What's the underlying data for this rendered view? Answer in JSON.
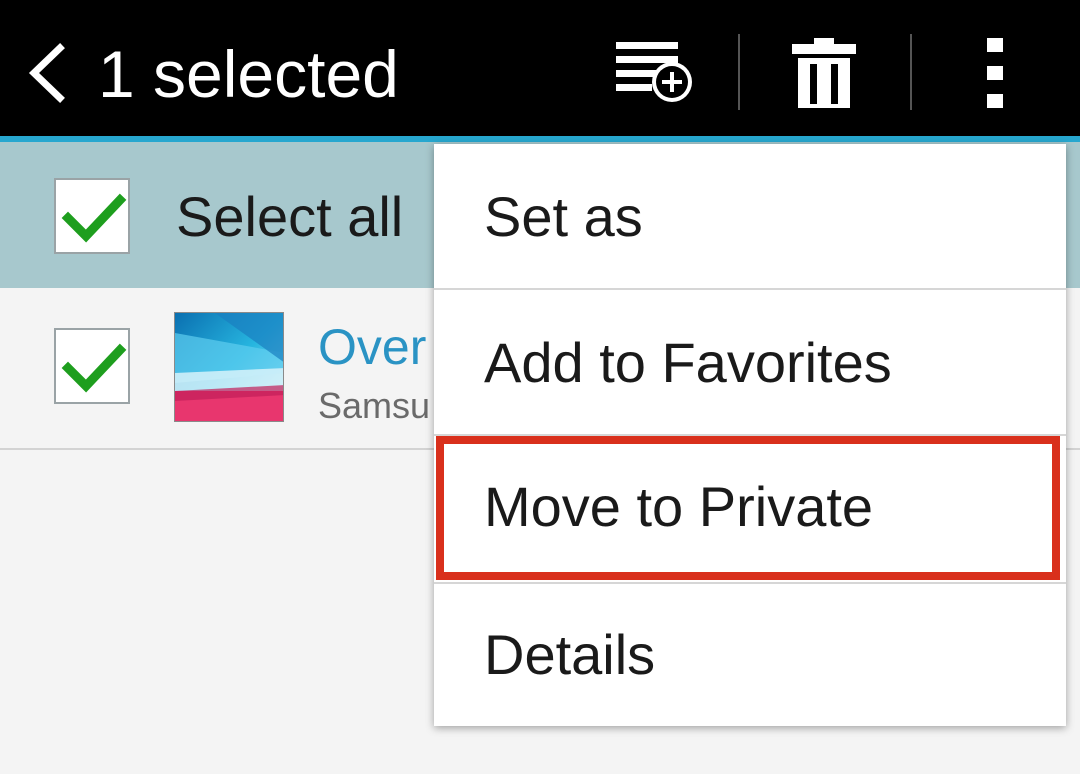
{
  "action_bar": {
    "title": "1 selected",
    "back_icon": "chevron-left-icon",
    "add_playlist_icon": "playlist-add-icon",
    "delete_icon": "trash-icon",
    "more_icon": "overflow-menu-icon",
    "accent_color": "#27a7cf"
  },
  "select_all": {
    "label": "Select all",
    "checked": true,
    "background": "#a7c8cd"
  },
  "list": {
    "items": [
      {
        "title": "Over",
        "subtitle": "Samsu",
        "checked": true,
        "thumbnail_icon": "album-art-thumbnail"
      }
    ]
  },
  "menu": {
    "items": [
      {
        "label": "Set as"
      },
      {
        "label": "Add to Favorites"
      },
      {
        "label": "Move to Private",
        "highlighted": true
      },
      {
        "label": "Details"
      }
    ],
    "highlight_color": "#d9301c"
  }
}
